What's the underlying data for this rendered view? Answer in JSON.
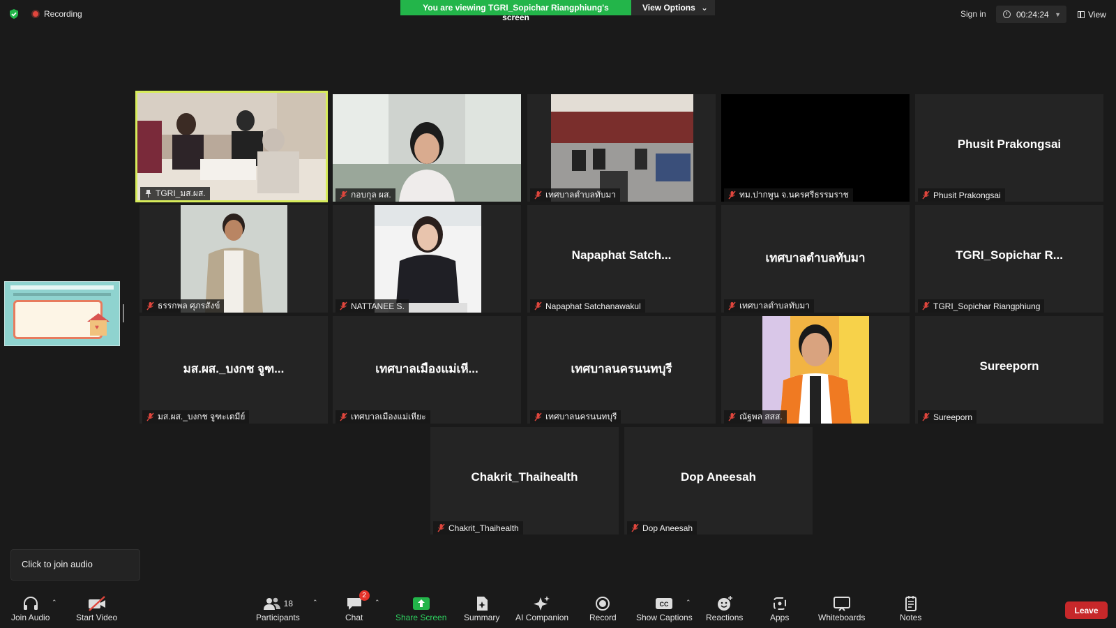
{
  "topbar": {
    "recording_label": "Recording",
    "viewing_banner": "You are viewing TGRI_Sopichar Riangphiung's screen",
    "view_options_label": "View Options",
    "sign_in_label": "Sign in",
    "timer": "00:24:24",
    "view_label": "View"
  },
  "tiles": [
    {
      "label": "TGRI_มส.ผส.",
      "big_name": "",
      "video": true,
      "pinned": true
    },
    {
      "label": "กอบกุล ผส.",
      "big_name": "",
      "video": true
    },
    {
      "label": "เทศบาลตำบลทับมา",
      "big_name": "",
      "video": true
    },
    {
      "label": "ทม.ปากพูน จ.นครศรีธรรมราช",
      "big_name": "",
      "video": true
    },
    {
      "label": "Phusit Prakongsai",
      "big_name": "Phusit Prakongsai",
      "video": false
    },
    {
      "label": "ธรรกพล ศุภรสังข์",
      "big_name": "",
      "video": true
    },
    {
      "label": "NATTANEE S.",
      "big_name": "",
      "video": true
    },
    {
      "label": "Napaphat Satchanawakul",
      "big_name": "Napaphat Satch...",
      "video": false
    },
    {
      "label": "เทศบาลตำบลทับมา",
      "big_name": "เทศบาลตำบลทับมา",
      "video": false
    },
    {
      "label": "TGRI_Sopichar Riangphiung",
      "big_name": "TGRI_Sopichar  R...",
      "video": false
    },
    {
      "label": "มส.ผส._บงกช จูฑะเตมีย์",
      "big_name": "มส.ผส._บงกช จูฑ...",
      "video": false
    },
    {
      "label": "เทศบาลเมืองแม่เหียะ",
      "big_name": "เทศบาลเมืองแม่เหี...",
      "video": false
    },
    {
      "label": "เทศบาลนครนนทบุรี",
      "big_name": "เทศบาลนครนนทบุรี",
      "video": false
    },
    {
      "label": "ณัฐพล  สสส.",
      "big_name": "",
      "video": true
    },
    {
      "label": "Sureeporn",
      "big_name": "Sureeporn",
      "video": false
    },
    {
      "label": "Chakrit_Thaihealth",
      "big_name": "Chakrit_Thaihealth",
      "video": false
    },
    {
      "label": "Dop Aneesah",
      "big_name": "Dop Aneesah",
      "video": false
    }
  ],
  "toast": "Click to join audio",
  "toolbar": {
    "join_audio": "Join Audio",
    "start_video": "Start Video",
    "participants": "Participants",
    "participants_count": "18",
    "chat": "Chat",
    "chat_badge": "2",
    "share_screen": "Share Screen",
    "summary": "Summary",
    "ai_companion": "AI Companion",
    "record": "Record",
    "show_captions": "Show Captions",
    "cc": "CC",
    "reactions": "Reactions",
    "apps": "Apps",
    "whiteboards": "Whiteboards",
    "notes": "Notes",
    "leave": "Leave"
  },
  "colors": {
    "accent_green": "#23b54a",
    "active_speaker": "#d7ec5b",
    "leave_red": "#c7282a",
    "mute_red": "#e0463d"
  },
  "icons": [
    "shield-icon",
    "record-dot-icon",
    "clock-icon",
    "grid-icon",
    "mic-off-icon",
    "pin-icon",
    "headphones-icon",
    "video-off-icon",
    "participants-icon",
    "chat-icon",
    "share-screen-icon",
    "summary-icon",
    "sparkle-icon",
    "record-icon",
    "captions-icon",
    "reactions-icon",
    "apps-icon",
    "whiteboard-icon",
    "notes-icon"
  ]
}
